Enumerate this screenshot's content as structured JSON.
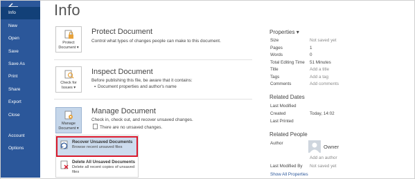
{
  "sidebar": {
    "items": [
      {
        "label": "Info",
        "active": true
      },
      {
        "label": "New"
      },
      {
        "label": "Open"
      },
      {
        "label": "Save"
      },
      {
        "label": "Save As"
      },
      {
        "label": "Print"
      },
      {
        "label": "Share"
      },
      {
        "label": "Export"
      },
      {
        "label": "Close"
      },
      {
        "label": "Account"
      },
      {
        "label": "Options"
      }
    ]
  },
  "page": {
    "title": "Info"
  },
  "protect": {
    "tile_line1": "Protect",
    "tile_line2": "Document",
    "title": "Protect Document",
    "desc": "Control what types of changes people can make to this document."
  },
  "inspect": {
    "tile_line1": "Check for",
    "tile_line2": "Issues",
    "title": "Inspect Document",
    "desc": "Before publishing this file, be aware that it contains:",
    "bullet": "Document properties and author's name"
  },
  "manage": {
    "tile_line1": "Manage",
    "tile_line2": "Document",
    "title": "Manage Document",
    "desc": "Check in, check out, and recover unsaved changes.",
    "note": "There are no unsaved changes."
  },
  "dropdown": {
    "recover_title": "Recover Unsaved Documents",
    "recover_sub": "Browse recent unsaved files",
    "delete_title": "Delete All Unsaved Documents",
    "delete_sub": "Delete all recent copies of unsaved files"
  },
  "properties": {
    "heading": "Properties",
    "rows": [
      {
        "label": "Size",
        "value": "Not saved yet"
      },
      {
        "label": "Pages",
        "value": "1"
      },
      {
        "label": "Words",
        "value": "0"
      },
      {
        "label": "Total Editing Time",
        "value": "51 Minutes"
      },
      {
        "label": "Title",
        "value": "Add a title"
      },
      {
        "label": "Tags",
        "value": "Add a tag"
      },
      {
        "label": "Comments",
        "value": "Add comments"
      }
    ]
  },
  "related_dates": {
    "heading": "Related Dates",
    "last_modified": "Last Modified",
    "created_label": "Created",
    "created_value": "Today, 14:02",
    "last_printed": "Last Printed"
  },
  "related_people": {
    "heading": "Related People",
    "author_label": "Author",
    "owner": "Owner",
    "add_author": "Add an author",
    "last_modified_by": "Last Modified By",
    "last_modified_by_value": "Not saved yet",
    "show_all": "Show All Properties"
  },
  "colors": {
    "sidebar": "#2b579a",
    "sidebar_active": "#124078",
    "highlight": "#d9182c"
  }
}
